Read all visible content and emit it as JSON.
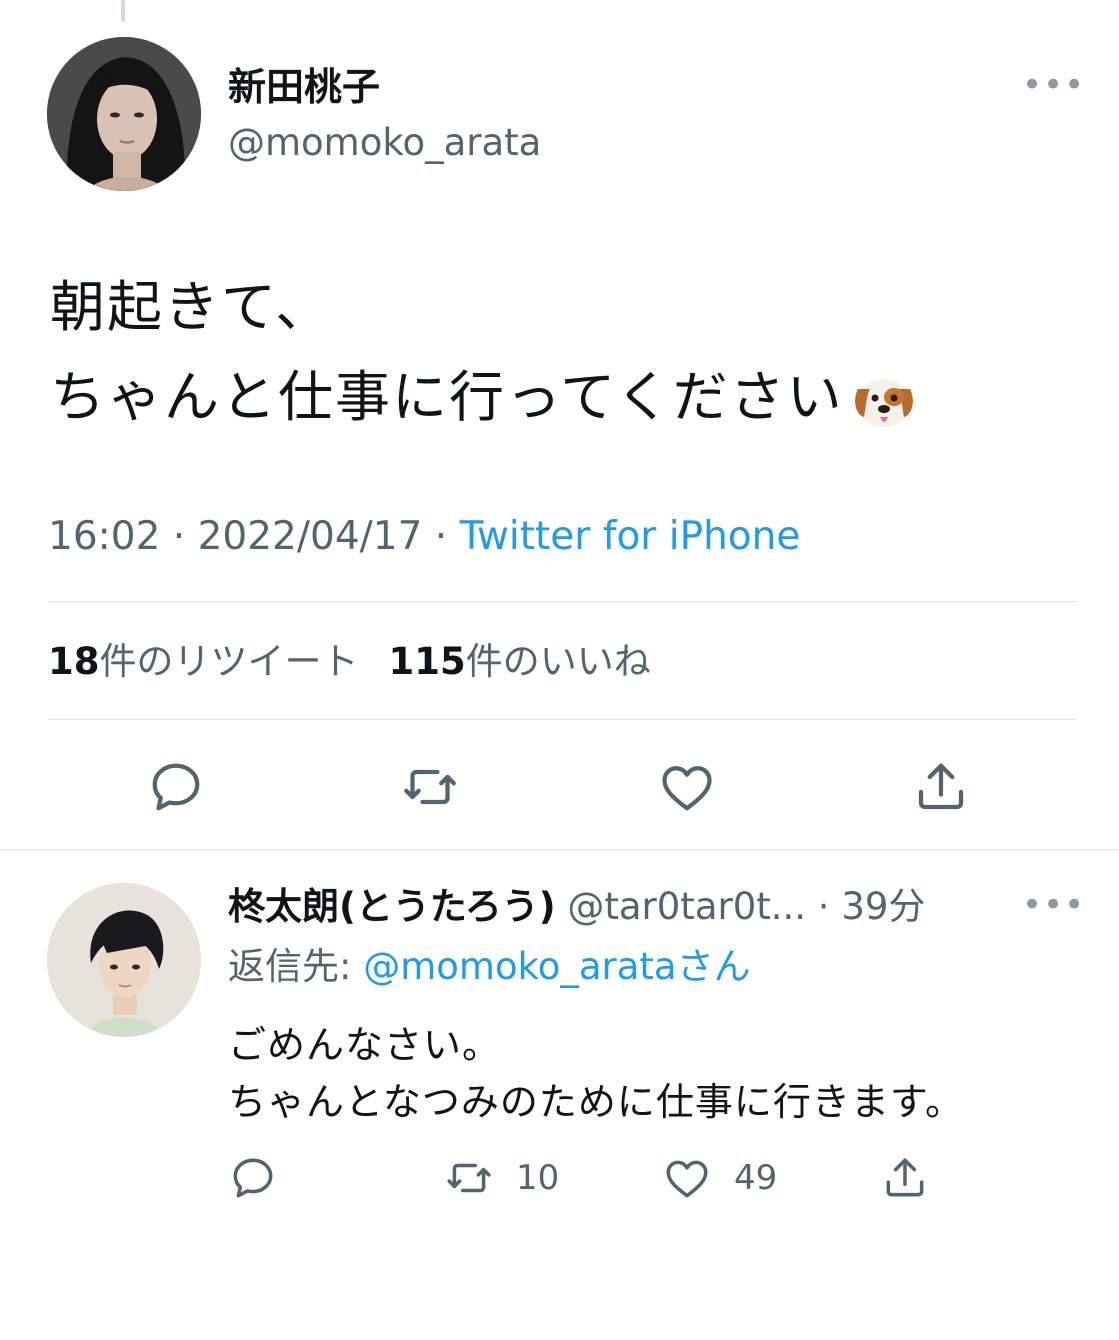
{
  "main_tweet": {
    "author_name": "新田桃子",
    "author_handle": "@momoko_arata",
    "more_icon": "more-horizontal-icon",
    "text_line1": "朝起きて、",
    "text_line2": "ちゃんと仕事に行ってください",
    "emoji": "dog-face-emoji",
    "time": "16:02",
    "date": "2022/04/17",
    "separator": " · ",
    "source": "Twitter for iPhone",
    "retweet_count": "18",
    "retweet_label": "件のリツイート",
    "like_count": "115",
    "like_label": "件のいいね",
    "actions": [
      "reply-icon",
      "retweet-icon",
      "like-icon",
      "share-icon"
    ]
  },
  "reply_tweet": {
    "author_name": "柊太朗(とうたろう)",
    "author_handle": "@tar0tar0t...",
    "separator": " · ",
    "time_ago": "39分",
    "reply_to_label": "返信先: ",
    "reply_to_mention": "@momoko_arataさん",
    "text_line1": "ごめんなさい。",
    "text_line2": "ちゃんとなつみのために仕事に行きます。",
    "retweet_count": "10",
    "like_count": "49",
    "actions": [
      "reply-icon",
      "retweet-icon",
      "like-icon",
      "share-icon"
    ]
  },
  "colors": {
    "text": "#0f1419",
    "secondary": "#536471",
    "link": "#1d9bf0",
    "divider": "#dfe3e6"
  }
}
